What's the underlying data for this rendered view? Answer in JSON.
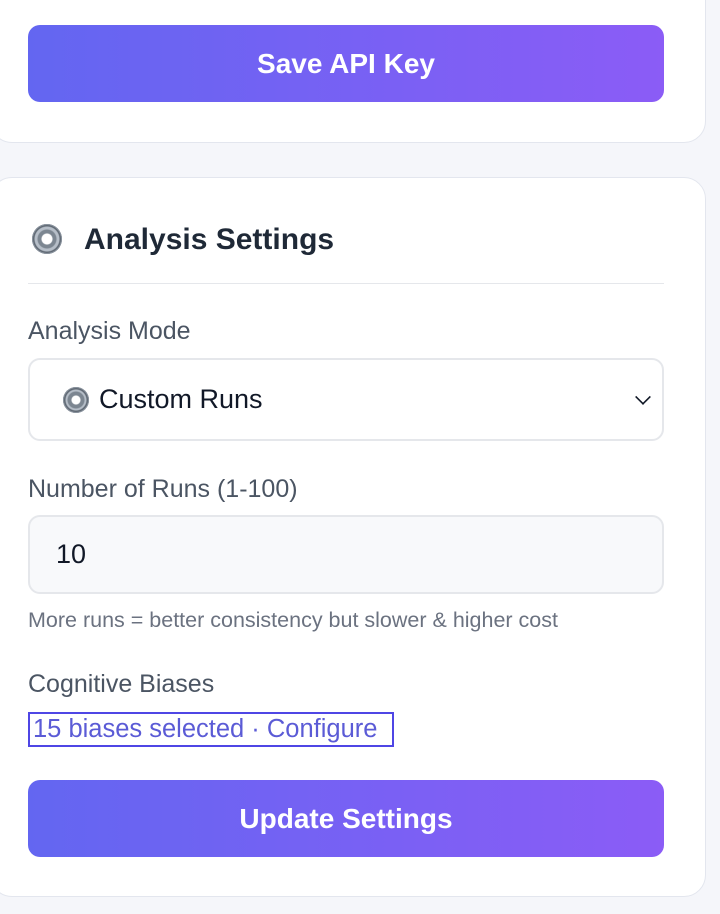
{
  "api_section": {
    "save_button": "Save API Key"
  },
  "analysis_settings": {
    "icon": "gear-icon",
    "title": "Analysis Settings",
    "mode": {
      "label": "Analysis Mode",
      "selected": "Custom Runs",
      "selected_icon": "gear-icon"
    },
    "runs": {
      "label": "Number of Runs (1-100)",
      "value": "10",
      "hint": "More runs = better consistency but slower & higher cost"
    },
    "biases": {
      "label": "Cognitive Biases",
      "link_text": "15 biases selected · Configure"
    },
    "update_button": "Update Settings"
  },
  "colors": {
    "accent_start": "#6366f1",
    "accent_end": "#8b5cf6",
    "link": "#5b5bd6"
  }
}
